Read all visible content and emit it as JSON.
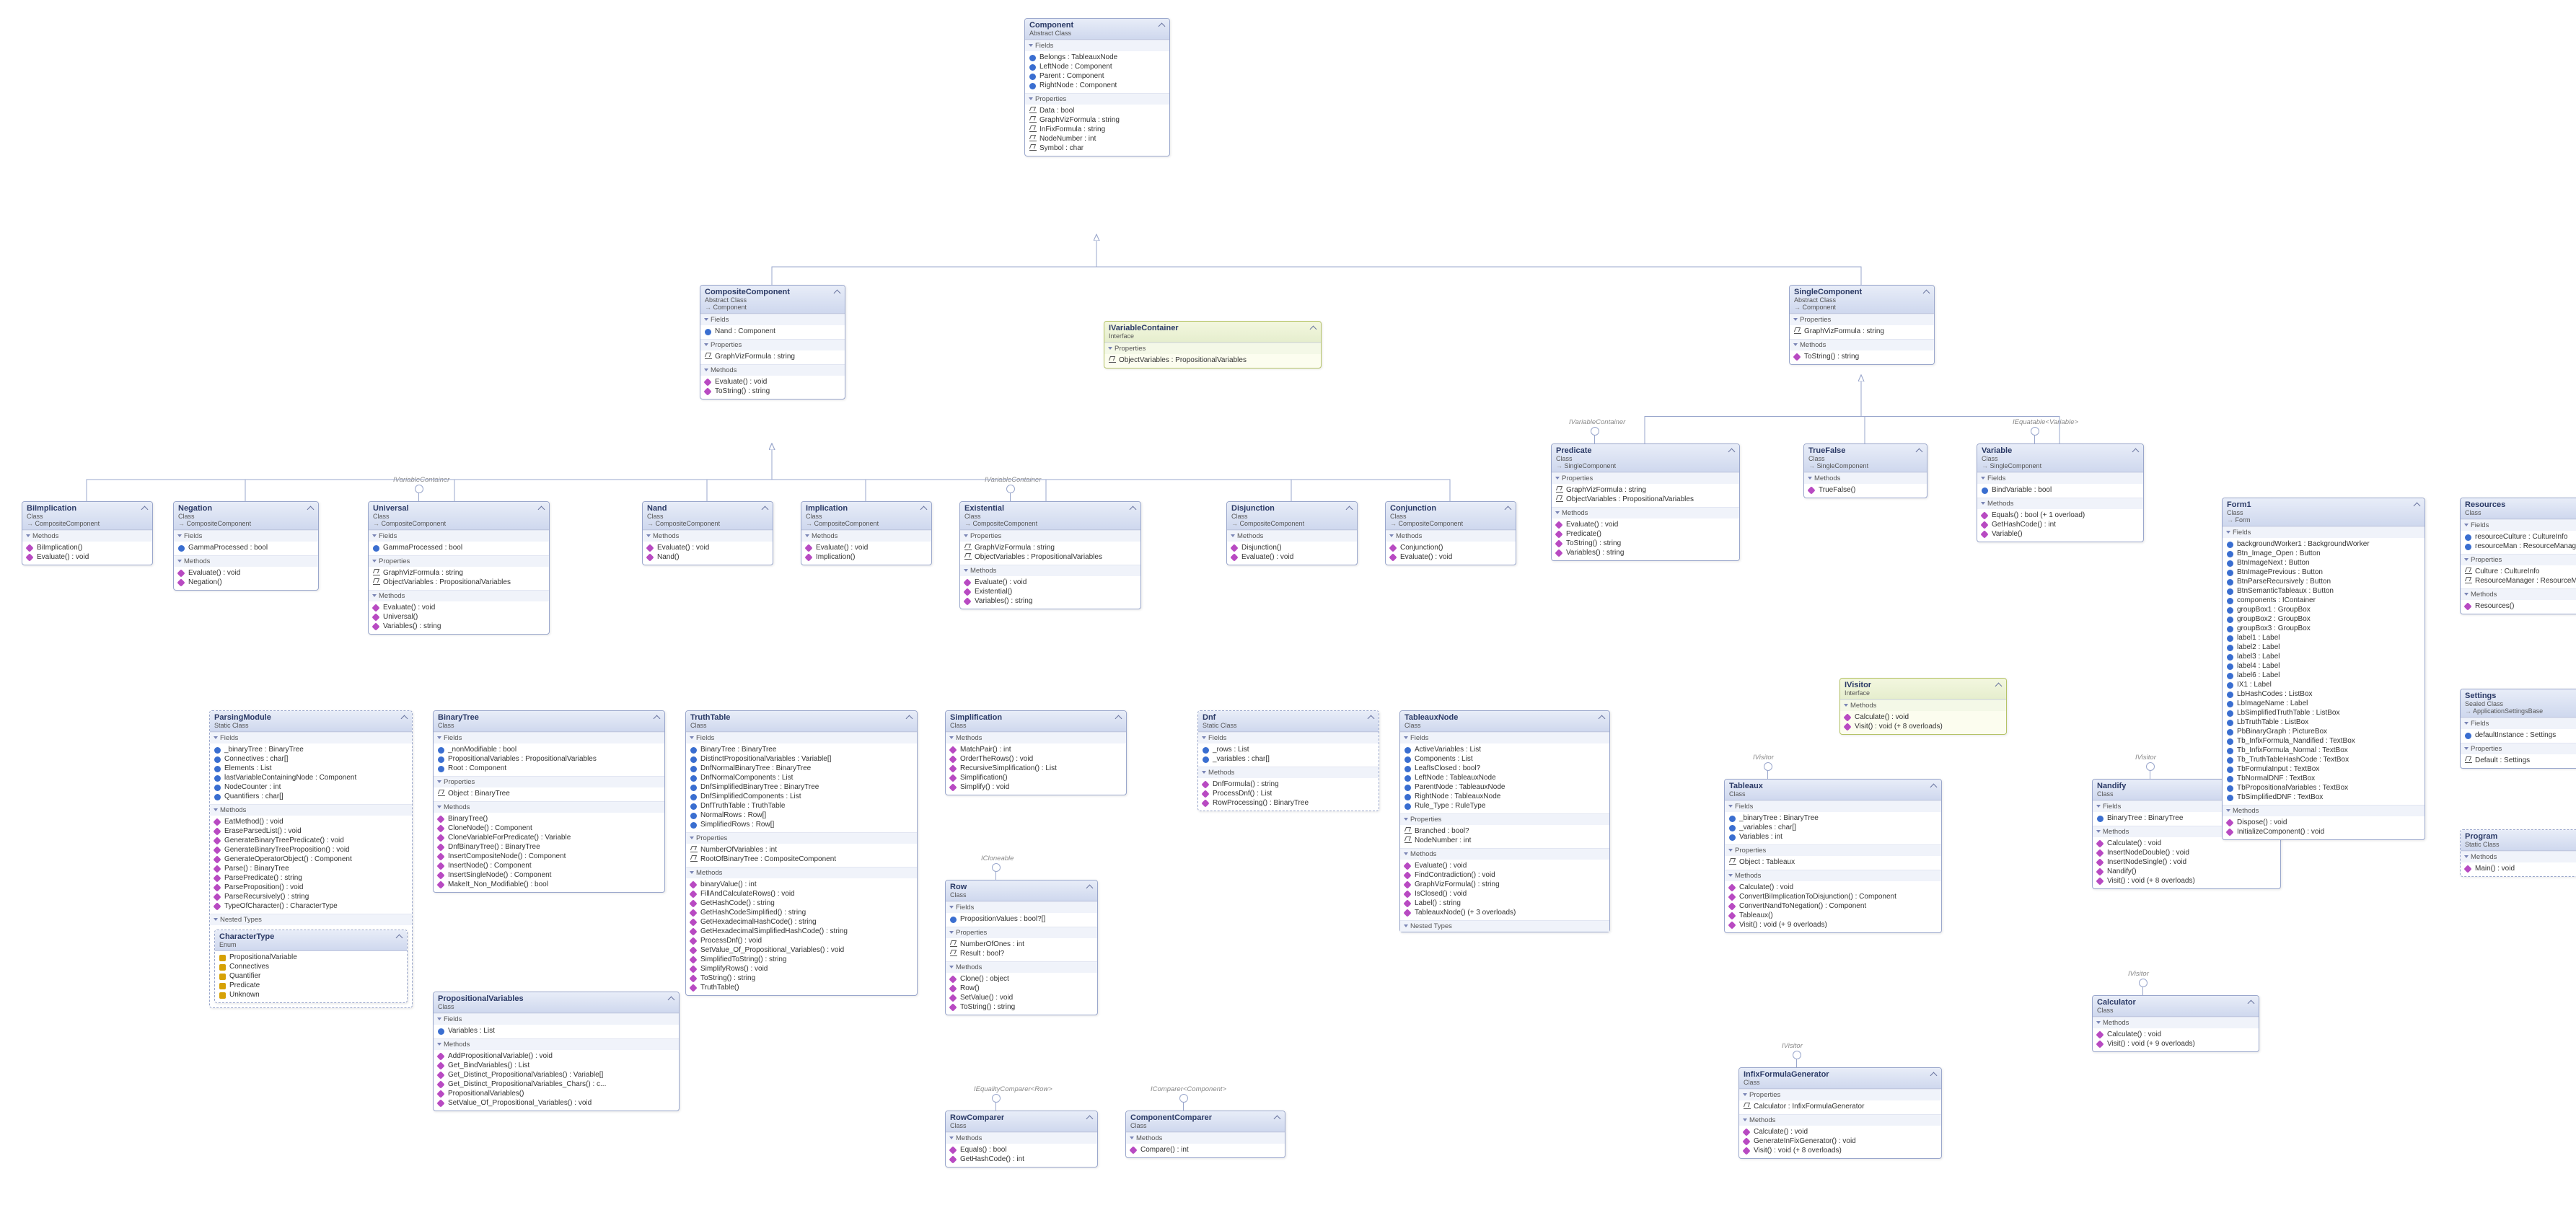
{
  "labels": {
    "fields": "Fields",
    "properties": "Properties",
    "methods": "Methods",
    "nestedTypes": "Nested Types"
  },
  "tags": {
    "ivisitor": "IVisitor",
    "ivariablecontainer": "IVariableContainer",
    "icloneable": "ICloneable",
    "iequatable_variable": "IEquatable<Variable>",
    "iequality_row": "IEqualityComparer<Row>",
    "icomparer_component": "IComparer<Component>"
  },
  "classes": {
    "Component": {
      "name": "Component",
      "sub": "Abstract Class",
      "fields": [
        "Belongs : TableauxNode",
        "LeftNode : Component",
        "Parent : Component",
        "RightNode : Component"
      ],
      "properties": [
        "Data : bool",
        "GraphVizFormula : string",
        "InFixFormula : string",
        "NodeNumber : int",
        "Symbol : char"
      ]
    },
    "CompositeComponent": {
      "name": "CompositeComponent",
      "sub": "Abstract Class",
      "inh": "Component",
      "fields": [
        "Nand : Component"
      ],
      "properties": [
        "GraphVizFormula : string"
      ],
      "methods": [
        "Evaluate() : void",
        "ToString() : string"
      ]
    },
    "IVariableContainer": {
      "name": "IVariableContainer",
      "sub": "Interface",
      "properties": [
        "ObjectVariables : PropositionalVariables"
      ]
    },
    "SingleComponent": {
      "name": "SingleComponent",
      "sub": "Abstract Class",
      "inh": "Component",
      "properties": [
        "GraphVizFormula : string"
      ],
      "methods": [
        "ToString() : string"
      ]
    },
    "BiImplication": {
      "name": "BiImplication",
      "sub": "Class",
      "inh": "CompositeComponent",
      "methods": [
        "BiImplication()",
        "Evaluate() : void"
      ]
    },
    "Negation": {
      "name": "Negation",
      "sub": "Class",
      "inh": "CompositeComponent",
      "fields": [
        "GammaProcessed : bool"
      ],
      "methods": [
        "Evaluate() : void",
        "Negation()"
      ]
    },
    "Universal": {
      "name": "Universal",
      "sub": "Class",
      "inh": "CompositeComponent",
      "fields": [
        "GammaProcessed : bool"
      ],
      "properties": [
        "GraphVizFormula : string",
        "ObjectVariables : PropositionalVariables"
      ],
      "methods": [
        "Evaluate() : void",
        "Universal()",
        "Variables() : string"
      ]
    },
    "Nand": {
      "name": "Nand",
      "sub": "Class",
      "inh": "CompositeComponent",
      "methods": [
        "Evaluate() : void",
        "Nand()"
      ]
    },
    "Implication": {
      "name": "Implication",
      "sub": "Class",
      "inh": "CompositeComponent",
      "methods": [
        "Evaluate() : void",
        "Implication()"
      ]
    },
    "Existential": {
      "name": "Existential",
      "sub": "Class",
      "inh": "CompositeComponent",
      "properties": [
        "GraphVizFormula : string",
        "ObjectVariables : PropositionalVariables"
      ],
      "methods": [
        "Evaluate() : void",
        "Existential()",
        "Variables() : string"
      ]
    },
    "Disjunction": {
      "name": "Disjunction",
      "sub": "Class",
      "inh": "CompositeComponent",
      "methods": [
        "Disjunction()",
        "Evaluate() : void"
      ]
    },
    "Conjunction": {
      "name": "Conjunction",
      "sub": "Class",
      "inh": "CompositeComponent",
      "methods": [
        "Conjunction()",
        "Evaluate() : void"
      ]
    },
    "Predicate": {
      "name": "Predicate",
      "sub": "Class",
      "inh": "SingleComponent",
      "properties": [
        "GraphVizFormula : string",
        "ObjectVariables : PropositionalVariables"
      ],
      "methods": [
        "Evaluate() : void",
        "Predicate()",
        "ToString() : string",
        "Variables() : string"
      ]
    },
    "TrueFalse": {
      "name": "TrueFalse",
      "sub": "Class",
      "inh": "SingleComponent",
      "methods": [
        "TrueFalse()"
      ]
    },
    "Variable": {
      "name": "Variable",
      "sub": "Class",
      "inh": "SingleComponent",
      "fields": [
        "BindVariable : bool"
      ],
      "methods": [
        "Equals() : bool (+ 1 overload)",
        "GetHashCode() : int",
        "Variable()"
      ]
    },
    "IVisitor": {
      "name": "IVisitor",
      "sub": "Interface",
      "methods": [
        "Calculate() : void",
        "Visit() : void (+ 8 overloads)"
      ]
    },
    "ParsingModule": {
      "name": "ParsingModule",
      "sub": "Static Class",
      "fields": [
        "_binaryTree : BinaryTree",
        "Connectives : char[]",
        "Elements : List<char>",
        "lastVariableContainingNode : Component",
        "NodeCounter : int",
        "Quantifiers : char[]"
      ],
      "methods": [
        "EatMethod() : void",
        "EraseParsedList() : void",
        "GenerateBinaryTreePredicate() : void",
        "GenerateBinaryTreeProposition() : void",
        "GenerateOperatorObject() : Component",
        "Parse() : BinaryTree",
        "ParsePredicate() : string",
        "ParseProposition() : void",
        "ParseRecursively() : string",
        "TypeOfCharacter() : CharacterType"
      ],
      "nested": {
        "name": "CharacterType",
        "sub": "Enum",
        "items": [
          "PropositionalVariable",
          "Connectives",
          "Quantifier",
          "Predicate",
          "Unknown"
        ]
      }
    },
    "BinaryTree": {
      "name": "BinaryTree",
      "sub": "Class",
      "fields": [
        "_nonModifiable : bool",
        "PropositionalVariables : PropositionalVariables",
        "Root : Component"
      ],
      "properties": [
        "Object : BinaryTree"
      ],
      "methods": [
        "BinaryTree()",
        "CloneNode() : Component",
        "CloneVariableForPredicate() : Variable",
        "DnfBinaryTree() : BinaryTree",
        "InsertCompositeNode() : Component",
        "InsertNode() : Component",
        "InsertSingleNode() : Component",
        "MakeIt_Non_Modifiable() : bool"
      ]
    },
    "PropositionalVariables": {
      "name": "PropositionalVariables",
      "sub": "Class",
      "fields": [
        "Variables : List<Variable>"
      ],
      "methods": [
        "AddPropositionalVariable() : void",
        "Get_BindVariables() : List<Variable>",
        "Get_Distinct_PropositionalVariables() : Variable[]",
        "Get_Distinct_PropositionalVariables_Chars() : c...",
        "PropositionalVariables()",
        "SetValue_Of_Propositional_Variables() : void"
      ]
    },
    "TruthTable": {
      "name": "TruthTable",
      "sub": "Class",
      "fields": [
        "BinaryTree : BinaryTree",
        "DistinctPropositionalVariables : Variable[]",
        "DnfNormalBinaryTree : BinaryTree",
        "DnfNormalComponents : List<BinaryTree>",
        "DnfSimplifiedBinaryTree : BinaryTree",
        "DnfSimplifiedComponents : List<BinaryTree>",
        "DnfTruthTable : TruthTable",
        "NormalRows : Row[]",
        "SimplifiedRows : Row[]"
      ],
      "properties": [
        "NumberOfVariables : int",
        "RootOfBinaryTree : CompositeComponent"
      ],
      "methods": [
        "binaryValue() : int",
        "FillAndCalculateRows() : void",
        "GetHashCode() : string",
        "GetHashCodeSimplified() : string",
        "GetHexadecimalHashCode() : string",
        "GetHexadecimalSimplifiedHashCode() : string",
        "ProcessDnf() : void",
        "SetValue_Of_Propositional_Variables() : void",
        "SimplifiedToString() : string",
        "SimplifyRows() : void",
        "ToString() : string",
        "TruthTable()"
      ]
    },
    "Simplification": {
      "name": "Simplification",
      "sub": "Class",
      "methods": [
        "MatchPair() : int",
        "OrderTheRows() : void",
        "RecursiveSimplification() : List<Row>",
        "Simplification()",
        "Simplify() : void"
      ]
    },
    "Row": {
      "name": "Row",
      "sub": "Class",
      "fields": [
        "PropositionValues : bool?[]"
      ],
      "properties": [
        "NumberOfOnes : int",
        "Result : bool?"
      ],
      "methods": [
        "Clone() : object",
        "Row()",
        "SetValue() : void",
        "ToString() : string"
      ]
    },
    "RowComparer": {
      "name": "RowComparer",
      "sub": "Class",
      "methods": [
        "Equals() : bool",
        "GetHashCode() : int"
      ]
    },
    "ComponentComparer": {
      "name": "ComponentComparer",
      "sub": "Class",
      "methods": [
        "Compare() : int"
      ]
    },
    "Dnf": {
      "name": "Dnf",
      "sub": "Static Class",
      "fields": [
        "_rows : List<Row>",
        "_variables : char[]"
      ],
      "methods": [
        "DnfFormula() : string",
        "ProcessDnf() : List<BinaryTree>",
        "RowProcessing() : BinaryTree"
      ]
    },
    "TableauxNode": {
      "name": "TableauxNode",
      "sub": "Class",
      "fields": [
        "ActiveVariables : List<char>",
        "Components : List<Component>",
        "LeafIsClosed : bool?",
        "LeftNode : TableauxNode",
        "ParentNode : TableauxNode",
        "RightNode : TableauxNode",
        "Rule_Type : RuleType"
      ],
      "properties": [
        "Branched : bool?",
        "NodeNumber : int"
      ],
      "methods": [
        "Evaluate() : void",
        "FindContradiction() : void",
        "GraphVizFormula() : string",
        "IsClosed() : void",
        "Label() : string",
        "TableauxNode() (+ 3 overloads)"
      ],
      "nestedCollapsed": true
    },
    "Tableaux": {
      "name": "Tableaux",
      "sub": "Class",
      "fields": [
        "_binaryTree : BinaryTree",
        "_variables : char[]",
        "Variables : int"
      ],
      "properties": [
        "Object : Tableaux"
      ],
      "methods": [
        "Calculate() : void",
        "ConvertBiImplicationToDisjunction() : Component",
        "ConvertNandToNegation() : Component",
        "Tableaux()",
        "Visit() : void (+ 9 overloads)"
      ]
    },
    "Nandify": {
      "name": "Nandify",
      "sub": "Class",
      "fields": [
        "BinaryTree : BinaryTree"
      ],
      "methods": [
        "Calculate() : void",
        "InsertNodeDouble() : void",
        "InsertNodeSingle() : void",
        "Nandify()",
        "Visit() : void (+ 8 overloads)"
      ]
    },
    "Calculator": {
      "name": "Calculator",
      "sub": "Class",
      "methods": [
        "Calculate() : void",
        "Visit() : void (+ 9 overloads)"
      ]
    },
    "InfixFormulaGenerator": {
      "name": "InfixFormulaGenerator",
      "sub": "Class",
      "properties": [
        "Calculator : InfixFormulaGenerator"
      ],
      "methods": [
        "Calculate() : void",
        "GenerateInFixGenerator() : void",
        "Visit() : void (+ 8 overloads)"
      ]
    },
    "Form1": {
      "name": "Form1",
      "sub": "Class",
      "inh": "Form",
      "fields": [
        "backgroundWorker1 : BackgroundWorker",
        "Btn_Image_Open : Button",
        "BtnImageNext : Button",
        "BtnImagePrevious : Button",
        "BtnParseRecursively : Button",
        "BtnSemanticTableaux : Button",
        "components : IContainer",
        "groupBox1 : GroupBox",
        "groupBox2 : GroupBox",
        "groupBox3 : GroupBox",
        "label1 : Label",
        "label2 : Label",
        "label3 : Label",
        "label4 : Label",
        "label6 : Label",
        "IX1 : Label",
        "LbHashCodes : ListBox",
        "LbImageName : Label",
        "LbSimplifiedTruthTable : ListBox",
        "LbTruthTable : ListBox",
        "PbBinaryGraph : PictureBox",
        "Tb_InfixFormula_Nandified : TextBox",
        "Tb_InfixFormula_Normal : TextBox",
        "Tb_TruthTableHashCode : TextBox",
        "TbFormulaInput : TextBox",
        "TbNormalDNF : TextBox",
        "TbPropositionalVariables : TextBox",
        "TbSimplifiedDNF : TextBox"
      ],
      "methods": [
        "Dispose() : void",
        "InitializeComponent() : void"
      ]
    },
    "Resources": {
      "name": "Resources",
      "sub": "Class",
      "fields": [
        "resourceCulture : CultureInfo",
        "resourceMan : ResourceManager"
      ],
      "properties": [
        "Culture : CultureInfo",
        "ResourceManager : ResourceManager"
      ],
      "methods": [
        "Resources()"
      ]
    },
    "Settings": {
      "name": "Settings",
      "sub": "Sealed Class",
      "inh": "ApplicationSettingsBase",
      "fields": [
        "defaultInstance : Settings"
      ],
      "properties": [
        "Default : Settings"
      ]
    },
    "Program": {
      "name": "Program",
      "sub": "Static Class",
      "methods": [
        "Main() : void"
      ]
    }
  }
}
